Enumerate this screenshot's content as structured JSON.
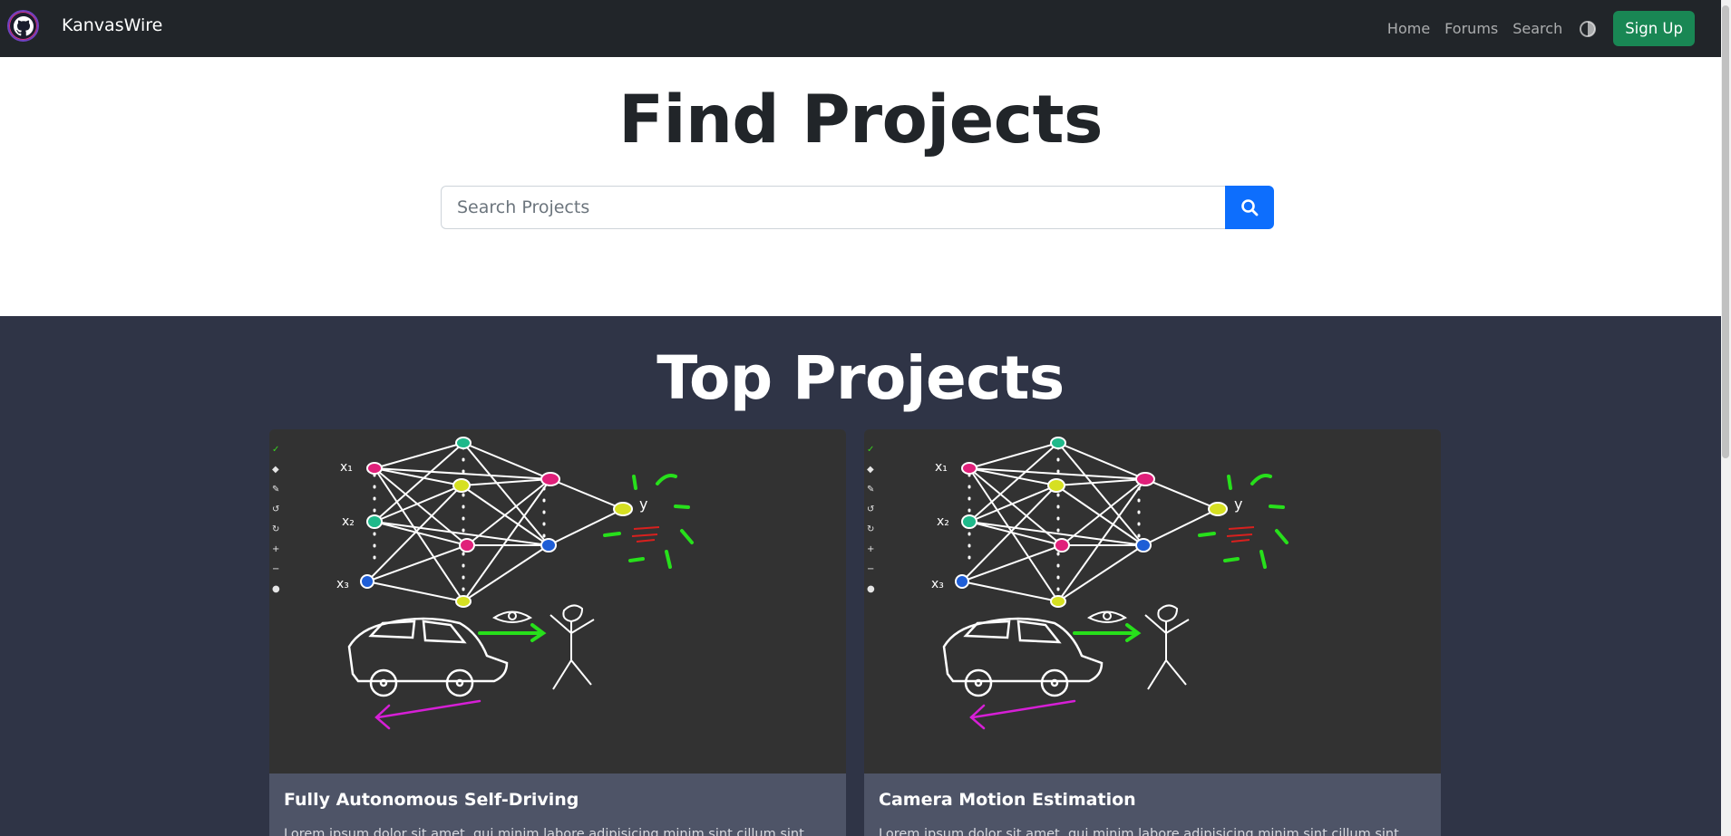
{
  "navbar": {
    "brand": "KanvasWire",
    "links": [
      "Home",
      "Forums",
      "Search"
    ],
    "theme_icon": "contrast-icon",
    "signup_label": "Sign Up"
  },
  "find": {
    "title": "Find Projects",
    "search_placeholder": "Search Projects",
    "search_icon": "search-icon"
  },
  "top": {
    "title": "Top Projects",
    "cards": [
      {
        "title": "Fully Autonomous Self-Driving",
        "text": "Lorem ipsum dolor sit amet, qui minim labore adipisicing minim sint cillum sint"
      },
      {
        "title": "Camera Motion Estimation",
        "text": "Lorem ipsum dolor sit amet, qui minim labore adipisicing minim sint cillum sint"
      }
    ]
  },
  "colors": {
    "navbar_bg": "#212529",
    "section_bg": "#2f3446",
    "card_bg": "#4e5467",
    "primary": "#0d6efd",
    "success": "#198754"
  }
}
